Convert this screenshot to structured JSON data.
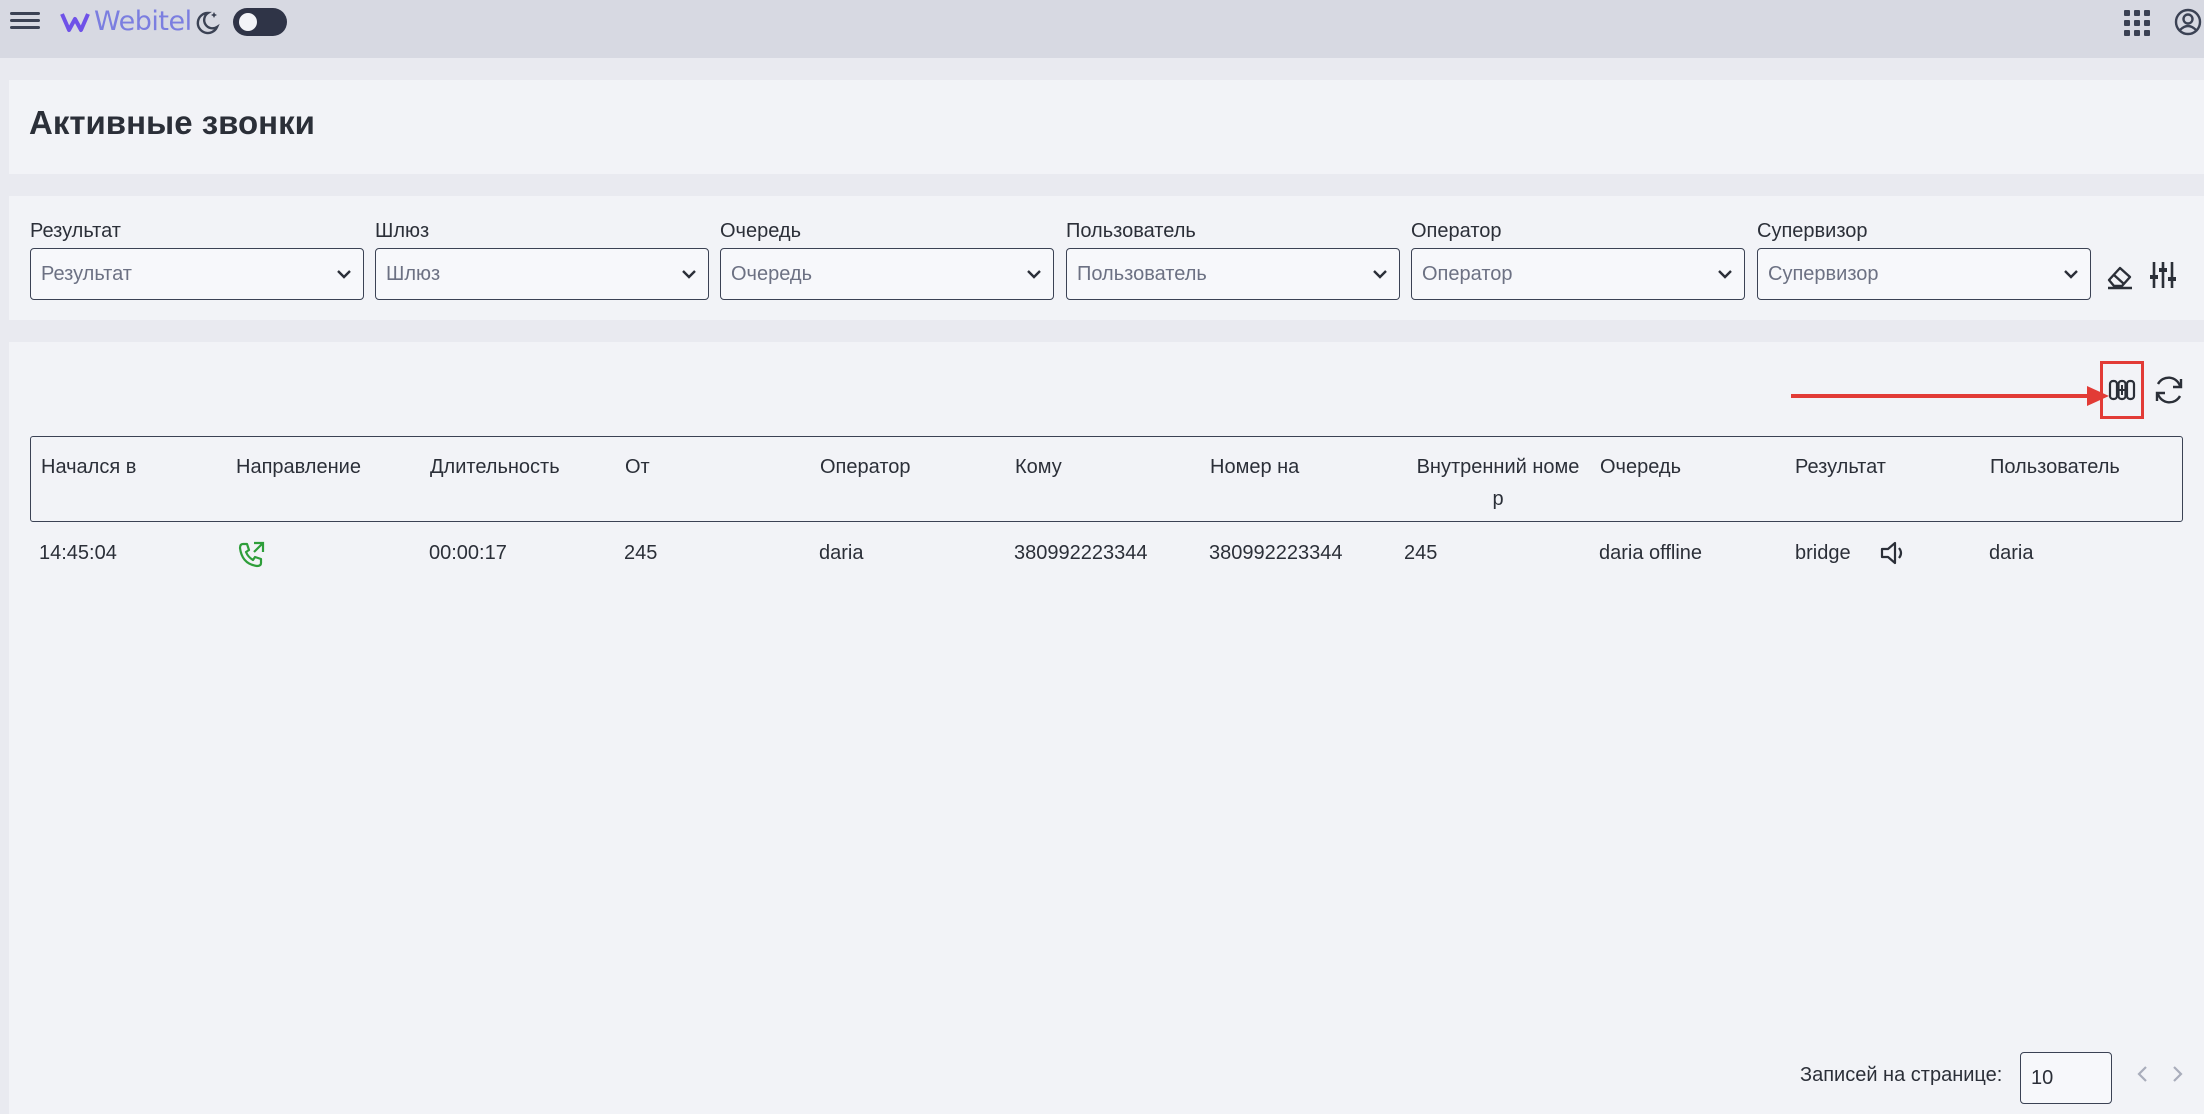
{
  "app": {
    "brand": "Webitel"
  },
  "page": {
    "title": "Активные звонки"
  },
  "filters": [
    {
      "label": "Результат",
      "placeholder": "Результат"
    },
    {
      "label": "Шлюз",
      "placeholder": "Шлюз"
    },
    {
      "label": "Очередь",
      "placeholder": "Очередь"
    },
    {
      "label": "Пользователь",
      "placeholder": "Пользователь"
    },
    {
      "label": "Оператор",
      "placeholder": "Оператор"
    },
    {
      "label": "Супервизор",
      "placeholder": "Супервизор"
    }
  ],
  "table": {
    "columns": [
      "Начался в",
      "Направление",
      "Длительность",
      "От",
      "Оператор",
      "Кому",
      "Номер на",
      "Внутренний номе\nр",
      "Очередь",
      "Результат",
      "Пользователь"
    ],
    "rows": [
      {
        "started": "14:45:04",
        "direction_icon": "phone-outbound-icon",
        "duration": "00:00:17",
        "from": "245",
        "operator": "daria",
        "to": "380992223344",
        "number": "380992223344",
        "extension": "245",
        "queue": "daria offline",
        "result": "bridge",
        "result_icon": "speaker-icon",
        "user": "daria"
      }
    ]
  },
  "pagination": {
    "label": "Записей на странице:",
    "per_page": "10"
  },
  "colors": {
    "accent": "#7b7ee0",
    "highlight": "#e23b36",
    "call_icon": "#2e9e3a"
  }
}
